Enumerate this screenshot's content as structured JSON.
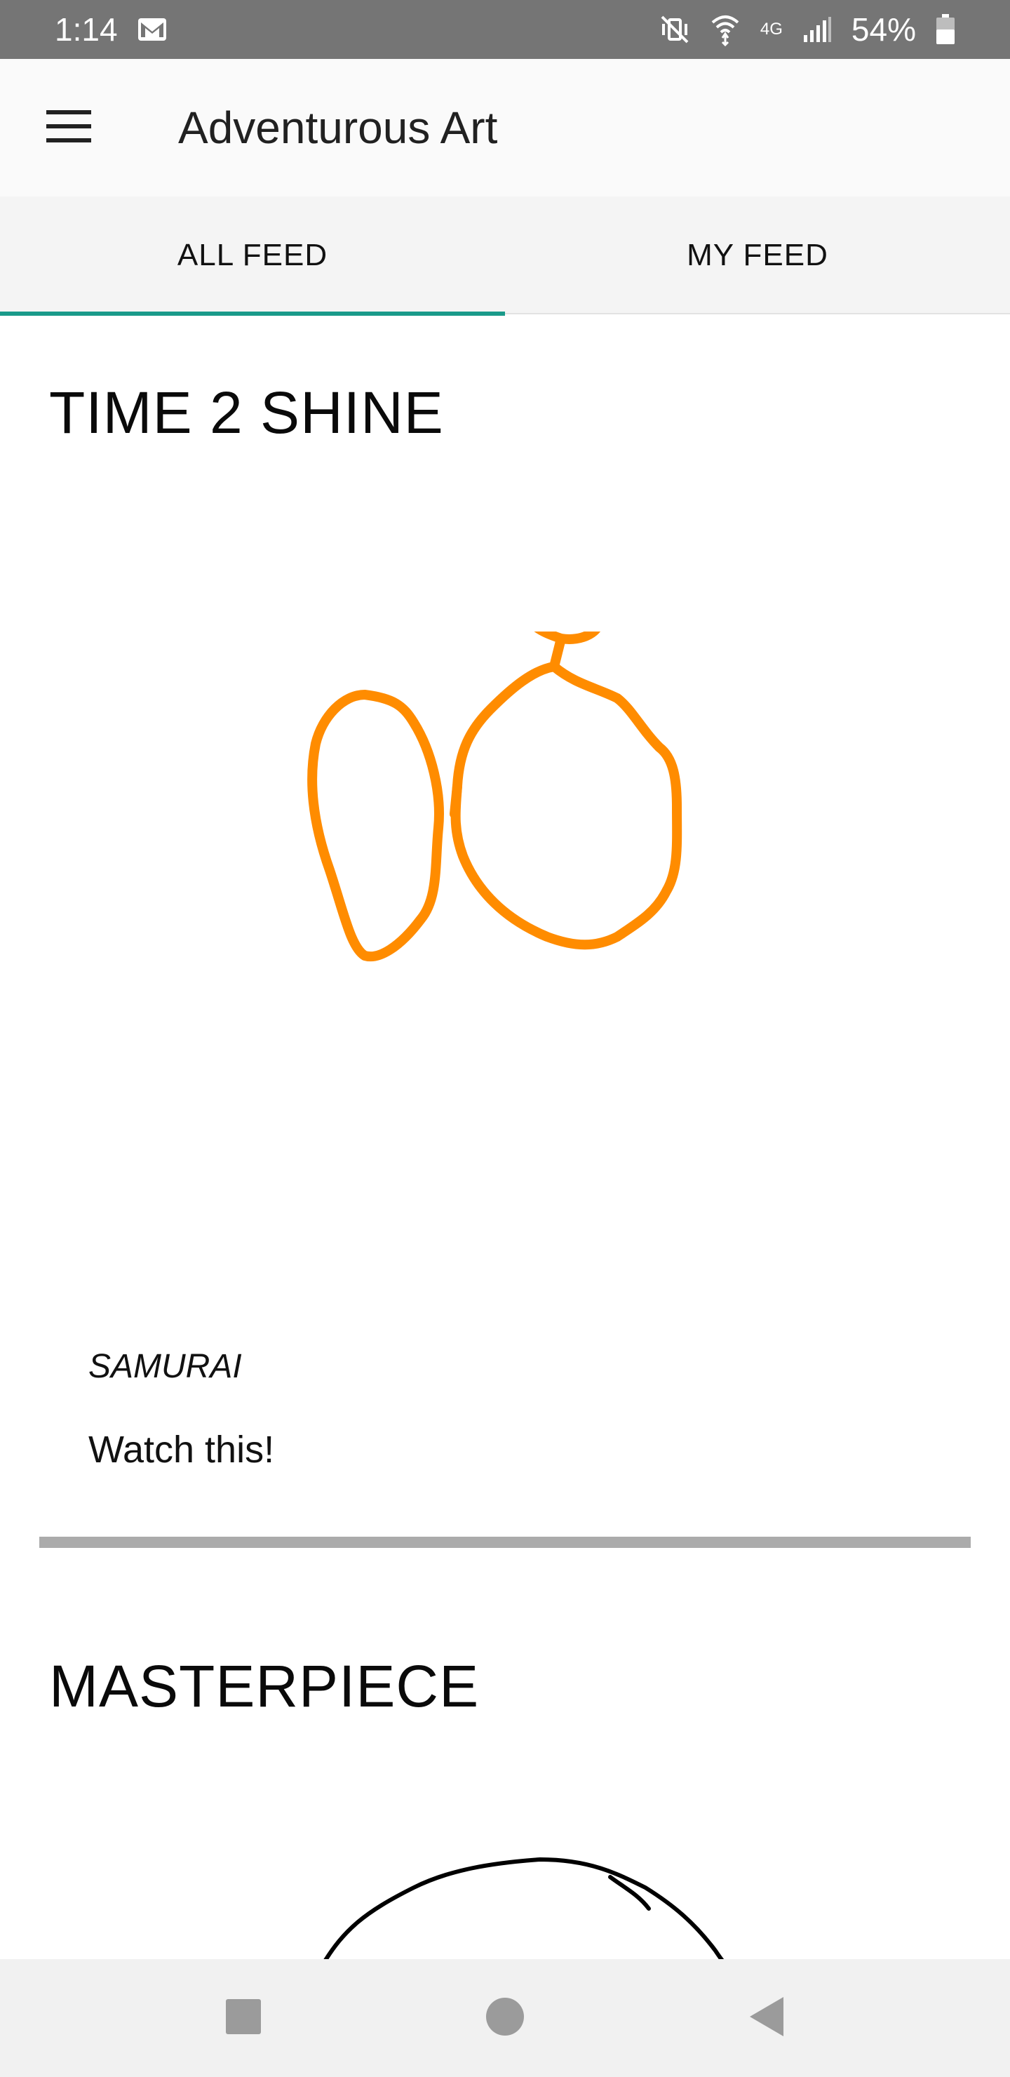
{
  "status_bar": {
    "time": "1:14",
    "battery": "54%",
    "network": "4G"
  },
  "app_bar": {
    "title": "Adventurous Art"
  },
  "tabs": [
    {
      "label": "ALL FEED",
      "selected": true
    },
    {
      "label": "MY FEED",
      "selected": false
    }
  ],
  "accent_color": "#1a9a8a",
  "posts": [
    {
      "title": "TIME 2 SHINE",
      "author": "SAMURAI",
      "caption": "Watch this!",
      "stroke_color": "#ff8c00"
    },
    {
      "title": "MASTERPIECE",
      "stroke_color": "#000000"
    }
  ],
  "icons": {
    "status_left": [
      "gmail-icon"
    ],
    "status_right": [
      "mute-vibrate-icon",
      "wifi-calling-icon",
      "lte-icon",
      "signal-icon",
      "battery-icon"
    ],
    "app_bar": "hamburger-menu-icon",
    "nav": [
      "recents-square-icon",
      "home-circle-icon",
      "back-triangle-icon"
    ]
  }
}
